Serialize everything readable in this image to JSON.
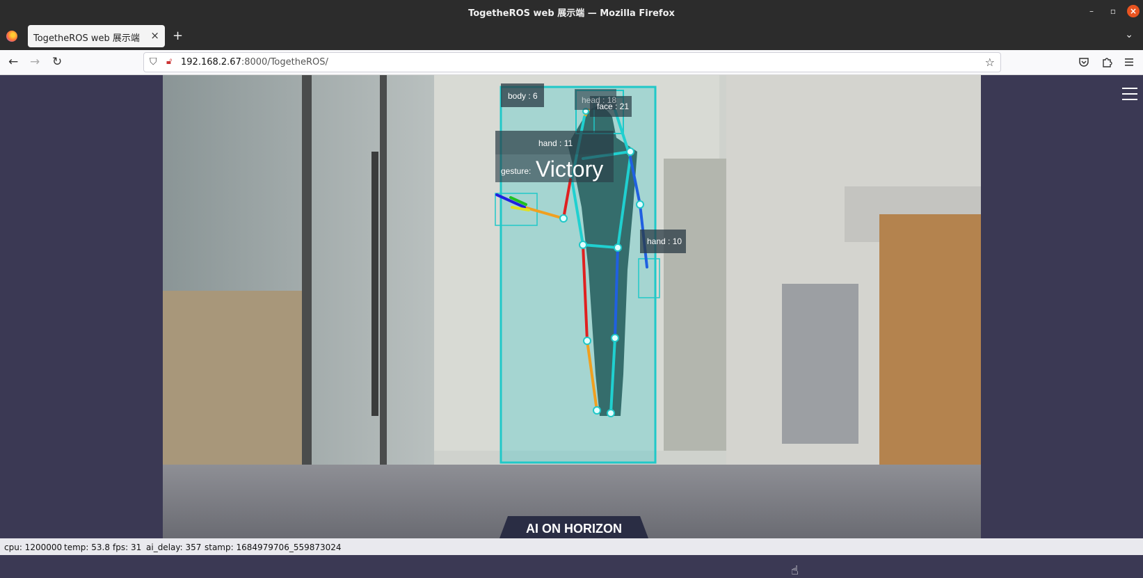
{
  "window": {
    "title": "TogetheROS web 展示端 — Mozilla Firefox"
  },
  "tab": {
    "label": "TogetheROS web 展示端",
    "close": "×"
  },
  "toolbar": {
    "new_tab": "+",
    "tab_list": "⌄",
    "back": "←",
    "forward": "→",
    "reload": "↻",
    "bookmark": "☆"
  },
  "url": {
    "host": "192.168.2.67",
    "rest": ":8000/TogetheROS/"
  },
  "overlay": {
    "body_label": "body : 6",
    "head_label": "head : 18",
    "face_label": "face : 21",
    "hand_left_label": "hand : 11",
    "gesture_prefix": "gesture:",
    "gesture_value": "Victory",
    "hand_right_label": "hand : 10",
    "brand": "AI ON HORIZON"
  },
  "status": {
    "cpu": "cpu: 1200000",
    "temp": "temp: 53.8",
    "fps": "fps: 31",
    "ai_delay": "ai_delay: 357",
    "stamp": "stamp: 1684979706_559873024"
  },
  "colors": {
    "box": "#20c8c8",
    "accent": "#e95420",
    "page_bg": "#3b3954"
  }
}
